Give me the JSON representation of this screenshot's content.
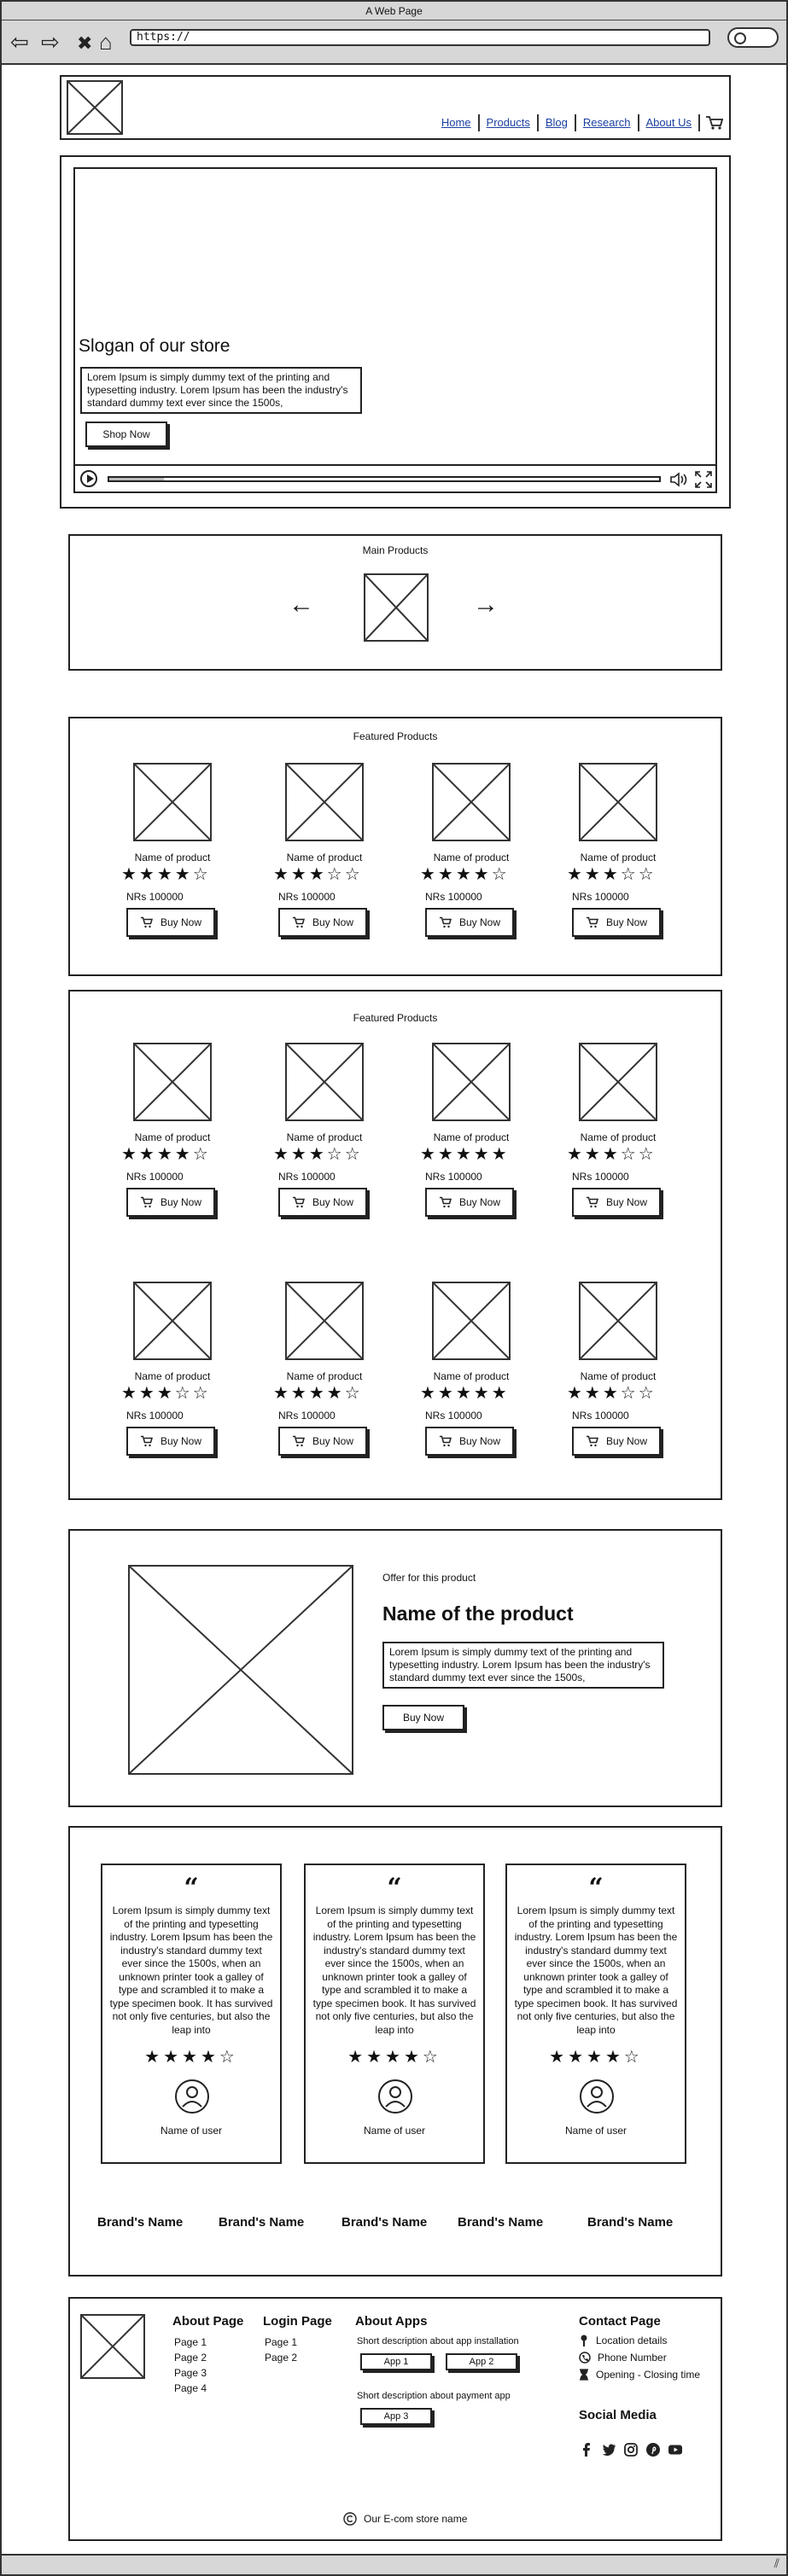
{
  "window": {
    "title": "A Web Page",
    "url": "https://"
  },
  "nav": [
    "Home",
    "Products",
    "Blog",
    "Research",
    "About Us"
  ],
  "hero": {
    "slogan": "Slogan of our store",
    "text": "Lorem Ipsum is simply dummy text of the printing and typesetting industry. Lorem Ipsum has been the industry's standard dummy text ever since the 1500s,",
    "button": "Shop Now",
    "progress": 0.1
  },
  "main_products": {
    "title": "Main Products",
    "prev": "←",
    "next": "→"
  },
  "featured_1": {
    "title": "Featured Products",
    "products": [
      {
        "name": "Name of product",
        "rating": 3.5,
        "stars": "★★★★☆",
        "price": "NRs 100000",
        "button": "Buy Now"
      },
      {
        "name": "Name of product",
        "rating": 3,
        "stars": "★★★☆☆",
        "price": "NRs 100000",
        "button": "Buy Now"
      },
      {
        "name": "Name of product",
        "rating": 4,
        "stars": "★★★★☆",
        "price": "NRs 100000",
        "button": "Buy Now"
      },
      {
        "name": "Name of product",
        "rating": 2.5,
        "stars": "★★★☆☆",
        "price": "NRs 100000",
        "button": "Buy Now"
      }
    ]
  },
  "featured_2": {
    "title": "Featured Products",
    "products": [
      {
        "name": "Name of product",
        "rating": 4,
        "stars": "★★★★☆",
        "price": "NRs 100000",
        "button": "Buy Now"
      },
      {
        "name": "Name of product",
        "rating": 3,
        "stars": "★★★☆☆",
        "price": "NRs 100000",
        "button": "Buy Now"
      },
      {
        "name": "Name of product",
        "rating": 4.5,
        "stars": "★★★★★",
        "price": "NRs 100000",
        "button": "Buy Now"
      },
      {
        "name": "Name of product",
        "rating": 3,
        "stars": "★★★☆☆",
        "price": "NRs 100000",
        "button": "Buy Now"
      },
      {
        "name": "Name of product",
        "rating": 3,
        "stars": "★★★☆☆",
        "price": "NRs 100000",
        "button": "Buy Now"
      },
      {
        "name": "Name of product",
        "rating": 3.5,
        "stars": "★★★★☆",
        "price": "NRs 100000",
        "button": "Buy Now"
      },
      {
        "name": "Name of product",
        "rating": 4.5,
        "stars": "★★★★★",
        "price": "NRs 100000",
        "button": "Buy Now"
      },
      {
        "name": "Name of product",
        "rating": 3,
        "stars": "★★★☆☆",
        "price": "NRs 100000",
        "button": "Buy Now"
      }
    ]
  },
  "offer": {
    "label": "Offer for this product",
    "name": "Name of the product",
    "text": "Lorem Ipsum is simply dummy text of the printing and typesetting industry. Lorem Ipsum has been the industry's standard dummy text ever since the 1500s,",
    "button": "Buy Now"
  },
  "testimonials": [
    {
      "quote_mark": "“",
      "text": "Lorem Ipsum is simply dummy text of the printing and typesetting industry. Lorem Ipsum has been the industry's standard dummy text ever since the 1500s, when an unknown printer took a galley of type and scrambled it to make a type specimen book. It has survived not only five centuries, but also the leap into",
      "rating": 3.5,
      "stars": "★★★★☆",
      "user": "Name of user"
    },
    {
      "quote_mark": "“",
      "text": "Lorem Ipsum is simply dummy text of the printing and typesetting industry. Lorem Ipsum has been the industry's standard dummy text ever since the 1500s, when an unknown printer took a galley of type and scrambled it to make a type specimen book. It has survived not only five centuries, but also the leap into",
      "rating": 4,
      "stars": "★★★★☆",
      "user": "Name of user"
    },
    {
      "quote_mark": "“",
      "text": "Lorem Ipsum is simply dummy text of the printing and typesetting industry. Lorem Ipsum has been the industry's standard dummy text ever since the 1500s, when an unknown printer took a galley of type and scrambled it to make a type specimen book. It has survived not only five centuries, but also the leap into",
      "rating": 4,
      "stars": "★★★★☆",
      "user": "Name of user"
    }
  ],
  "brands": [
    "Brand's Name",
    "Brand's Name",
    "Brand's Name",
    "Brand's Name",
    "Brand's Name"
  ],
  "footer": {
    "about": {
      "title": "About Page",
      "items": [
        "Page 1",
        "Page 2",
        "Page 3",
        "Page 4"
      ]
    },
    "login": {
      "title": "Login Page",
      "items": [
        "Page 1",
        "Page 2"
      ]
    },
    "apps": {
      "title": "About Apps",
      "install_desc": "Short description about app installation",
      "app1": "App 1",
      "app2": "App 2",
      "payment_desc": "Short description about payment app",
      "app3": "App 3"
    },
    "contact": {
      "title": "Contact Page",
      "location": "Location details",
      "phone": "Phone Number",
      "hours": "Opening - Closing time"
    },
    "social": {
      "title": "Social Media",
      "icons": [
        "facebook-icon",
        "twitter-icon",
        "instagram-icon",
        "pinterest-icon",
        "youtube-icon"
      ]
    },
    "copyright": "Our E-com store name"
  }
}
